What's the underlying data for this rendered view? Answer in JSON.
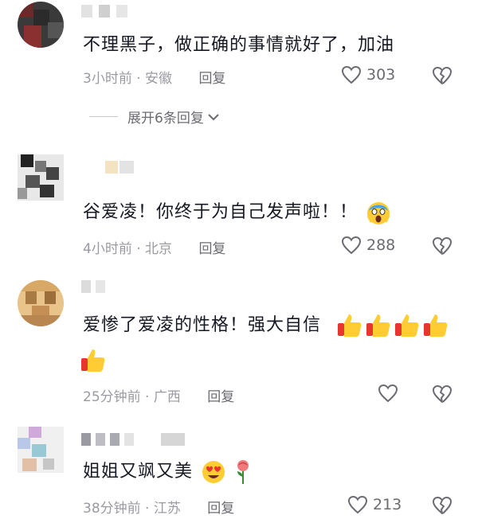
{
  "comments": [
    {
      "text": "不理黑子，做正确的事情就好了，加油",
      "time_location": "3小时前 · 安徽",
      "reply_label": "回复",
      "like_count": "303",
      "expand_label": "展开6条回复"
    },
    {
      "text": "谷爱凌！你终于为自己发声啦！！",
      "time_location": "4小时前 · 北京",
      "reply_label": "回复",
      "like_count": "288",
      "emojis": [
        "scream-emoji"
      ]
    },
    {
      "text": "爱惨了爱凌的性格！强大自信",
      "time_location": "25分钟前 · 广西",
      "reply_label": "回复",
      "like_count": "",
      "emojis": [
        "thumbs-up-emoji",
        "thumbs-up-emoji",
        "thumbs-up-emoji",
        "thumbs-up-emoji",
        "thumbs-up-emoji"
      ]
    },
    {
      "text": "姐姐又飒又美",
      "time_location": "38分钟前 · 江苏",
      "reply_label": "回复",
      "like_count": "213",
      "emojis": [
        "heart-eyes-emoji",
        "rose-emoji"
      ]
    }
  ],
  "colors": {
    "text": "#161823",
    "meta": "#9a9aa2",
    "icon": "#6b6b72"
  }
}
